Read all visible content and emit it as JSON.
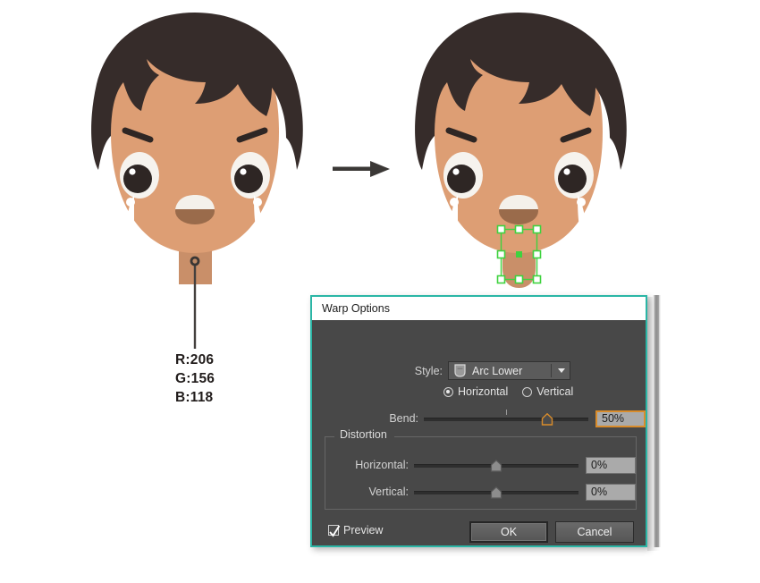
{
  "illustration": {
    "left_character": {
      "name": "crying-boy-original",
      "colors": {
        "hair": "#362C2A",
        "skin": "#DD9E74",
        "skin_shadow": "#C98F69",
        "mouth": "#9A6B4B",
        "mouth_teeth": "#F4F1EB",
        "eye_white": "#F6F3EE",
        "pupil": "#2E2624",
        "tear": "#FFFFFF"
      }
    },
    "right_character": {
      "name": "crying-boy-warped",
      "selection_handle_color": "#3FD23F",
      "selection_center_color": "#3FD23F"
    },
    "arrow": {
      "name": "right-arrow",
      "color": "#3B3836"
    },
    "callout": {
      "name": "color-value-callout",
      "lines": [
        "R:206",
        "G:156",
        "B:118"
      ],
      "r_label": "R:206",
      "g_label": "G:156",
      "b_label": "B:118",
      "swatch_hex": "#CE9C76",
      "leader_color": "#44403E"
    }
  },
  "dialog": {
    "title": "Warp Options",
    "border_color": "#2BB6A6",
    "body_color": "#484848",
    "style": {
      "label": "Style:",
      "value": "Arc Lower",
      "icon": "arc-lower-icon",
      "dropdown_icon": "chevron-down-icon"
    },
    "orientation": {
      "horizontal_label": "Horizontal",
      "vertical_label": "Vertical",
      "selected": "Horizontal"
    },
    "bend": {
      "label": "Bend:",
      "value": "50%",
      "slider_percent": 75,
      "tick_percent": 50,
      "field_focused": true,
      "accent_color": "#D98C2B"
    },
    "distortion": {
      "legend": "Distortion",
      "horizontal": {
        "label": "Horizontal:",
        "value": "0%",
        "slider_percent": 50
      },
      "vertical": {
        "label": "Vertical:",
        "value": "0%",
        "slider_percent": 50
      }
    },
    "footer": {
      "preview_label": "Preview",
      "preview_checked": true,
      "ok_label": "OK",
      "cancel_label": "Cancel"
    }
  }
}
